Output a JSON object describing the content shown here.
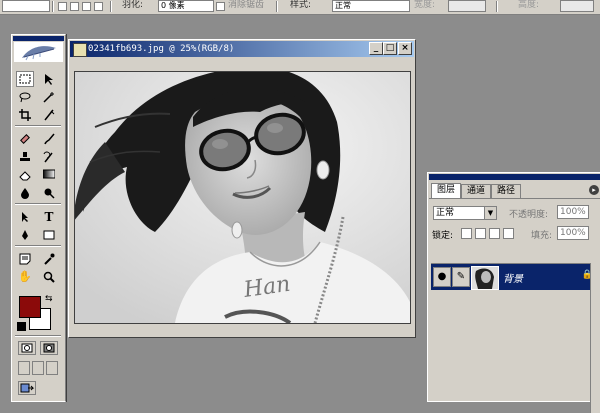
{
  "options_bar": {
    "feather_label": "羽化:",
    "feather_value": "0 像素",
    "antialias_label": "消除锯齿",
    "style_label": "样式:",
    "style_value": "正常",
    "width_label": "宽度:",
    "height_label": "高度:"
  },
  "document": {
    "title": "02341fb693.jpg @ 25%(RGB/8)",
    "buttons": {
      "minimize": "_",
      "maximize": "□",
      "close": "×"
    },
    "image_description_icon": "photo-grayscale"
  },
  "toolbox": {
    "tools": [
      "marquee-icon",
      "move-icon",
      "lasso-icon",
      "magic-wand-icon",
      "crop-icon",
      "slice-icon",
      "healing-brush-icon",
      "brush-icon",
      "clone-stamp-icon",
      "history-brush-icon",
      "eraser-icon",
      "gradient-icon",
      "blur-icon",
      "dodge-icon",
      "path-select-icon",
      "type-icon",
      "pen-icon",
      "shape-icon",
      "notes-icon",
      "eyedropper-icon",
      "hand-icon",
      "zoom-icon"
    ],
    "foreground_color": "#8b0a0a",
    "background_color": "#ffffff"
  },
  "layers_panel": {
    "tabs": [
      "图层",
      "通道",
      "路径"
    ],
    "blend_mode": "正常",
    "opacity_label": "不透明度:",
    "opacity_value": "100%",
    "lock_label": "锁定:",
    "fill_label": "填充:",
    "fill_value": "100%",
    "layer_name": "背景"
  },
  "colors": {
    "workspace": "#8c8c8c",
    "chrome": "#d4d0c8",
    "titlebar": "#0a246a",
    "selection": "#0a246a"
  }
}
